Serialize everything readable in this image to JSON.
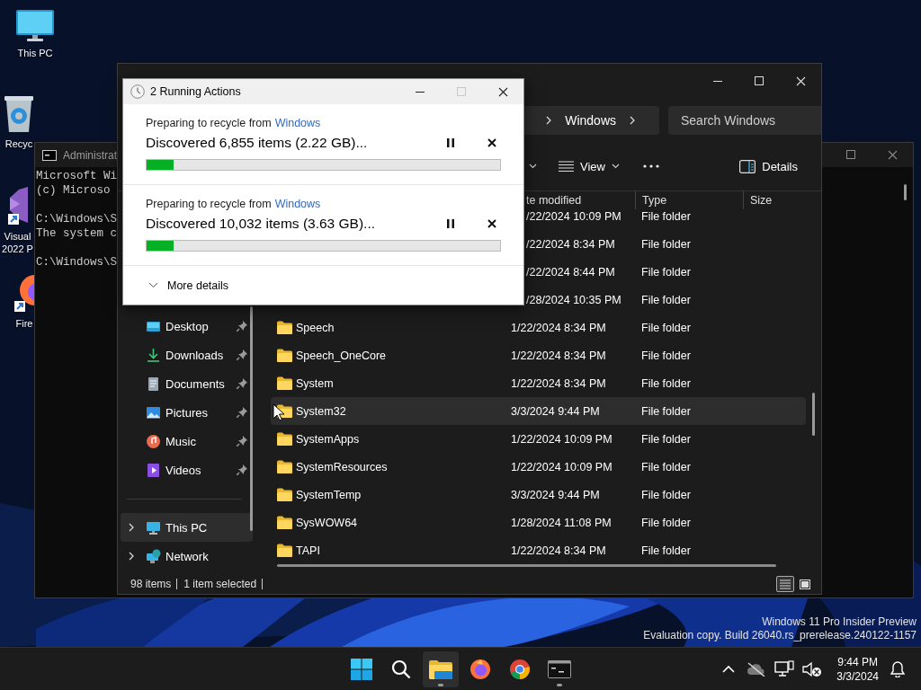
{
  "desktop": {
    "icons": [
      {
        "kind": "pc",
        "label": "This PC"
      },
      {
        "kind": "recycle_bin",
        "label": "Recyc"
      },
      {
        "kind": "visual_studio",
        "label": "Visual 2022 P"
      },
      {
        "kind": "firefox",
        "label": "Fire"
      }
    ],
    "watermark": [
      "Windows 11 Pro Insider Preview",
      "Evaluation copy. Build 26040.rs_prerelease.240122-1157"
    ]
  },
  "console_window": {
    "title": "Administrat",
    "output": [
      [
        "Microsoft Wi",
        "(c) Microso"
      ],
      [
        "C:\\Windows\\S",
        "The system c"
      ],
      [
        "C:\\Windows\\S"
      ]
    ]
  },
  "explorer": {
    "address": {
      "crumbs": [
        "Windows"
      ]
    },
    "search": {
      "placeholder": "Search Windows"
    },
    "toolbar": [
      {
        "kind": "caret"
      },
      {
        "kind": "view",
        "label": "View"
      },
      {
        "kind": "more"
      },
      {
        "kind": "details",
        "label": "Details"
      }
    ],
    "nav_items": [
      {
        "kind": "desktop",
        "label": "Desktop",
        "pinned": true,
        "expandable": false,
        "selected": false
      },
      {
        "kind": "downloads",
        "label": "Downloads",
        "pinned": true,
        "expandable": false,
        "selected": false
      },
      {
        "kind": "documents",
        "label": "Documents",
        "pinned": true,
        "expandable": false,
        "selected": false
      },
      {
        "kind": "pictures",
        "label": "Pictures",
        "pinned": true,
        "expandable": false,
        "selected": false
      },
      {
        "kind": "music",
        "label": "Music",
        "pinned": true,
        "expandable": false,
        "selected": false
      },
      {
        "kind": "videos",
        "label": "Videos",
        "pinned": true,
        "expandable": false,
        "selected": false
      },
      {
        "kind": "pc",
        "label": "This PC",
        "pinned": false,
        "expandable": true,
        "selected": true
      },
      {
        "kind": "network",
        "label": "Network",
        "pinned": false,
        "expandable": true,
        "selected": false
      }
    ],
    "columns": [
      "te modified",
      "Type",
      "Size"
    ],
    "rows": [
      {
        "date": "/22/2024 10:09 PM",
        "type": "File folder",
        "selected": false
      },
      {
        "date": "/22/2024 8:34 PM",
        "type": "File folder",
        "selected": false
      },
      {
        "date": "/22/2024 8:44 PM",
        "type": "File folder",
        "selected": false
      },
      {
        "date": "/28/2024 10:35 PM",
        "type": "File folder",
        "selected": false
      },
      {
        "name": "Speech",
        "date": "1/22/2024 8:34 PM",
        "type": "File folder",
        "selected": false
      },
      {
        "name": "Speech_OneCore",
        "date": "1/22/2024 8:34 PM",
        "type": "File folder",
        "selected": false
      },
      {
        "name": "System",
        "date": "1/22/2024 8:34 PM",
        "type": "File folder",
        "selected": false
      },
      {
        "name": "System32",
        "date": "3/3/2024 9:44 PM",
        "type": "File folder",
        "selected": true
      },
      {
        "name": "SystemApps",
        "date": "1/22/2024 10:09 PM",
        "type": "File folder",
        "selected": false
      },
      {
        "name": "SystemResources",
        "date": "1/22/2024 10:09 PM",
        "type": "File folder",
        "selected": false
      },
      {
        "name": "SystemTemp",
        "date": "3/3/2024 9:44 PM",
        "type": "File folder",
        "selected": false
      },
      {
        "name": "SysWOW64",
        "date": "1/28/2024 11:08 PM",
        "type": "File folder",
        "selected": false
      },
      {
        "name": "TAPI",
        "date": "1/22/2024 8:34 PM",
        "type": "File folder",
        "selected": false
      }
    ],
    "status": [
      "98 items",
      "1 item selected"
    ],
    "view_modes": [
      {
        "kind": "details",
        "selected": true
      },
      {
        "kind": "tiles",
        "selected": false
      }
    ]
  },
  "dialog": {
    "title": "2 Running Actions",
    "controls": [
      {
        "kind": "minimize",
        "disabled": false
      },
      {
        "kind": "maximize",
        "disabled": true
      },
      {
        "kind": "close",
        "disabled": false
      }
    ],
    "operations": [
      {
        "label": "Preparing to recycle from",
        "source": "Windows",
        "status": "Discovered 6,855 items (2.22 GB)...",
        "level": 0.076
      },
      {
        "label": "Preparing to recycle from",
        "source": "Windows",
        "status": "Discovered 10,032 items (3.63 GB)...",
        "level": 0.076
      }
    ],
    "more_details": "More details"
  },
  "taskbar": {
    "apps": [
      {
        "kind": "start",
        "active": false,
        "running": false
      },
      {
        "kind": "search",
        "active": false,
        "running": false
      },
      {
        "kind": "explorer",
        "active": true,
        "running": true
      },
      {
        "kind": "firefox",
        "active": false,
        "running": false
      },
      {
        "kind": "chrome",
        "active": false,
        "running": false
      },
      {
        "kind": "terminal",
        "active": false,
        "running": true
      }
    ],
    "tray": [
      {
        "kind": "chevron"
      },
      {
        "kind": "cloud_off"
      },
      {
        "kind": "network"
      },
      {
        "kind": "volume_muted"
      }
    ],
    "time": "9:44 PM",
    "date": "3/3/2024"
  }
}
